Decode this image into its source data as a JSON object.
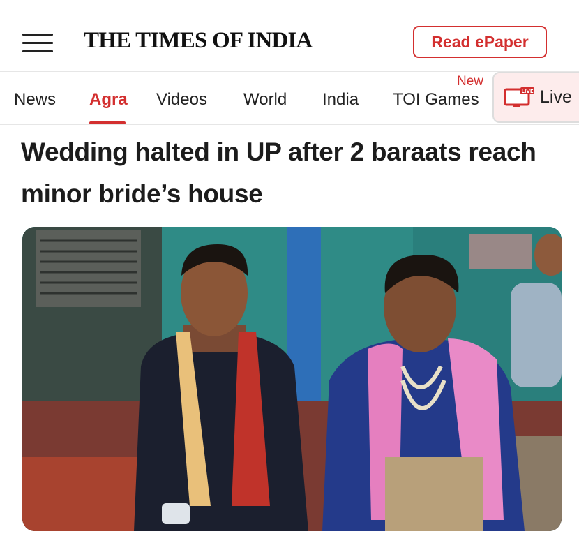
{
  "header": {
    "menu_icon": "hamburger-menu-icon",
    "logo_text": "THE TIMES OF INDIA",
    "epaper_label": "Read ePaper"
  },
  "nav": {
    "items": [
      {
        "label": "News"
      },
      {
        "label": "Agra"
      },
      {
        "label": "Videos"
      },
      {
        "label": "World"
      },
      {
        "label": "India"
      },
      {
        "label": "TOI Games"
      }
    ],
    "active": "Agra",
    "new_badge": "New",
    "live_label": "Live",
    "live_icon": "live-tv-icon",
    "live_icon_badge": "LIVE"
  },
  "article": {
    "headline": "Wedding halted in UP after 2 baraats reach minor bride’s house"
  },
  "colors": {
    "accent": "#d32f2f",
    "live_bg": "#fdecec"
  }
}
